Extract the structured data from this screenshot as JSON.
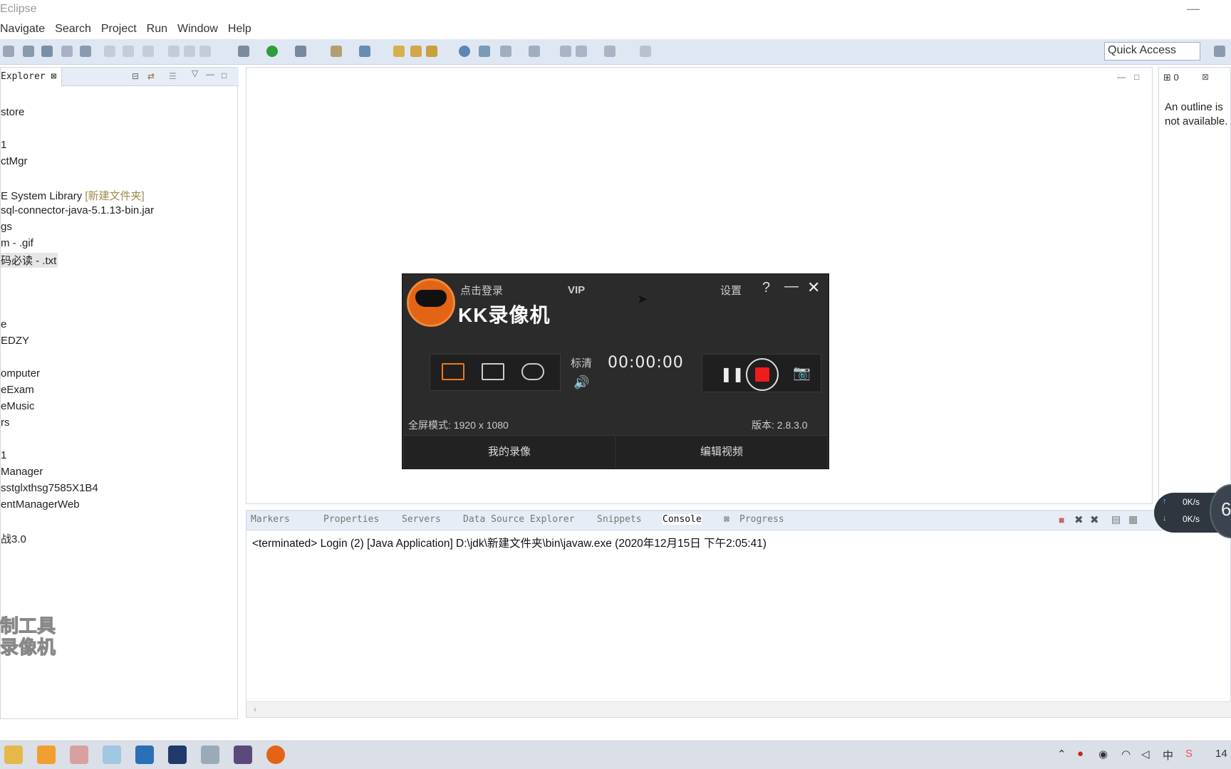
{
  "window": {
    "title": "Eclipse",
    "minimize": "—"
  },
  "menu": [
    "Navigate",
    "Search",
    "Project",
    "Run",
    "Window",
    "Help"
  ],
  "quick_access": "Quick Access",
  "explorer": {
    "tab_label": "Explorer",
    "items": [
      "store",
      "1",
      "ctMgr",
      "E System Library",
      "sql-connector-java-5.1.13-bin.jar",
      "gs",
      "m - .gif",
      "码必读 - .txt",
      "e",
      "EDZY",
      "omputer",
      "eExam",
      "eMusic",
      "rs",
      "1",
      "Manager",
      "sstglxthsg7585X1B4",
      "entManagerWeb",
      "战3.0"
    ],
    "decoration": "[新建文件夹]"
  },
  "outline": {
    "tab": "0",
    "message": "An outline is not available."
  },
  "console": {
    "tabs": [
      "Markers",
      "Properties",
      "Servers",
      "Data Source Explorer",
      "Snippets",
      "Console",
      "Progress"
    ],
    "active_tab": "Console",
    "terminated": "<terminated> Login (2) [Java Application] D:\\jdk\\新建文件夹\\bin\\javaw.exe (2020年12月15日 下午2:05:41)"
  },
  "kk": {
    "login": "点击登录",
    "vip": "VIP",
    "settings": "设置",
    "help": "?",
    "brand": "KK录像机",
    "quality": "标清",
    "timer": "00:00:00",
    "full_mode": "全屏模式: 1920 x 1080",
    "version": "版本: 2.8.3.0",
    "my_recordings": "我的录像",
    "edit_video": "编辑视频"
  },
  "net": {
    "up": "0K/s",
    "down": "0K/s",
    "badge": "6"
  },
  "watermark": [
    "制工具",
    "录像机"
  ],
  "taskbar": {
    "ime": "中",
    "clock": "14"
  }
}
